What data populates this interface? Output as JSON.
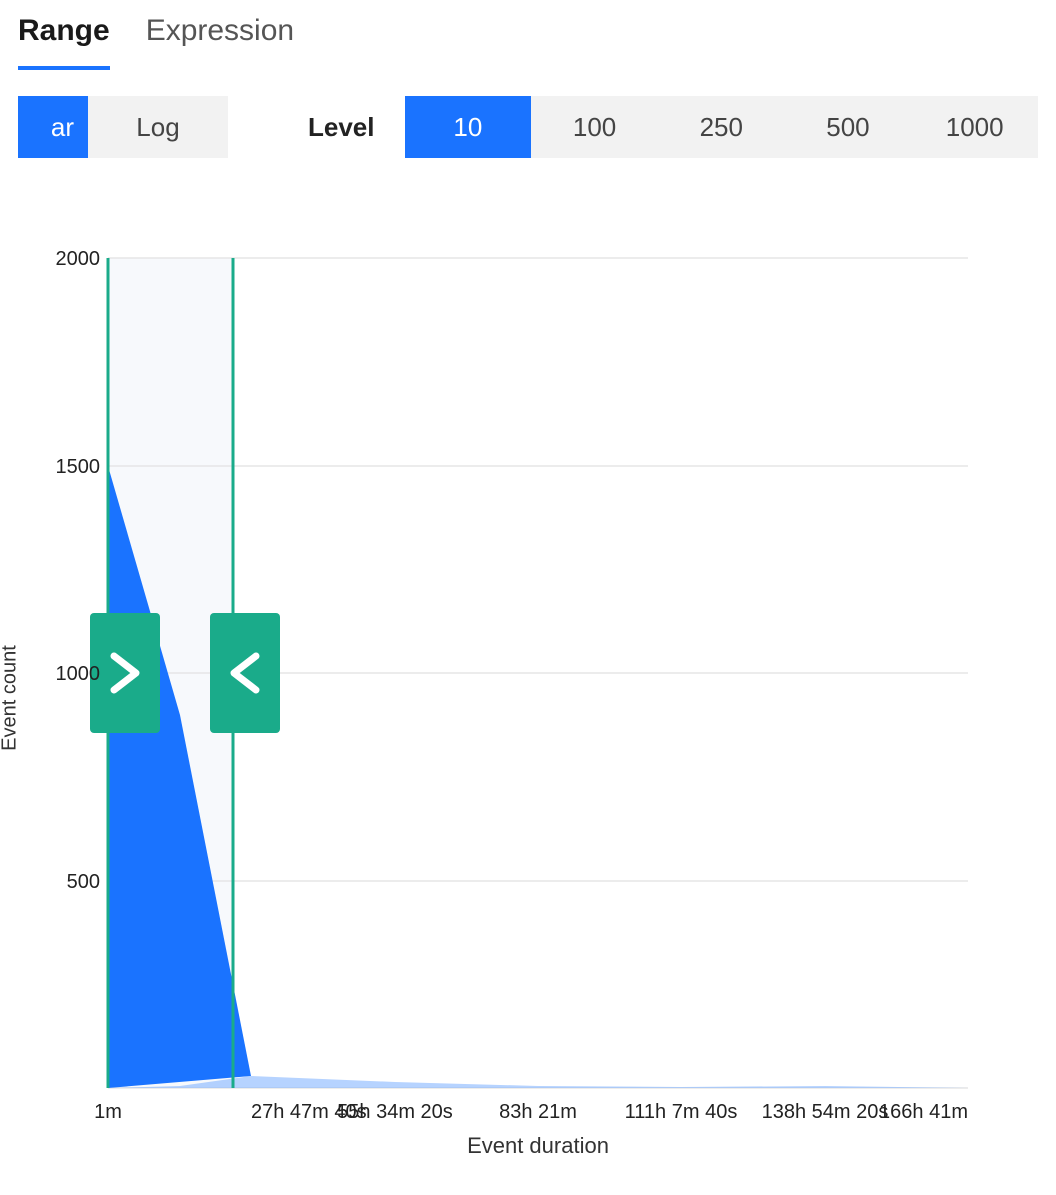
{
  "tabs": {
    "range": "Range",
    "expression": "Expression",
    "active": "range"
  },
  "scale": {
    "linear": "ar",
    "log": "Log",
    "active": "linear"
  },
  "level_label": "Level",
  "levels": {
    "options": [
      "10",
      "100",
      "250",
      "500",
      "1000"
    ],
    "active": "10"
  },
  "chart_data": {
    "type": "area",
    "title": "",
    "xlabel": "Event duration",
    "ylabel": "Event count",
    "ylim": [
      0,
      2000
    ],
    "y_ticks": [
      "2000",
      "1500",
      "1000",
      "500"
    ],
    "x_ticks": [
      "1m",
      "27h 47m 40s",
      "55h 34m 20s",
      "83h 21m",
      "111h 7m 40s",
      "138h 54m 20s",
      "166h 41m"
    ],
    "series": [
      {
        "name": "Event count",
        "x_index": [
          0,
          0.5,
          1,
          2,
          3,
          4,
          5,
          6
        ],
        "values": [
          1500,
          900,
          30,
          15,
          5,
          2,
          5,
          0
        ]
      }
    ],
    "selection": {
      "from_label": "1m",
      "to_label": "27h 47m 40s",
      "from_index": 0,
      "to_index": 0.87
    }
  }
}
